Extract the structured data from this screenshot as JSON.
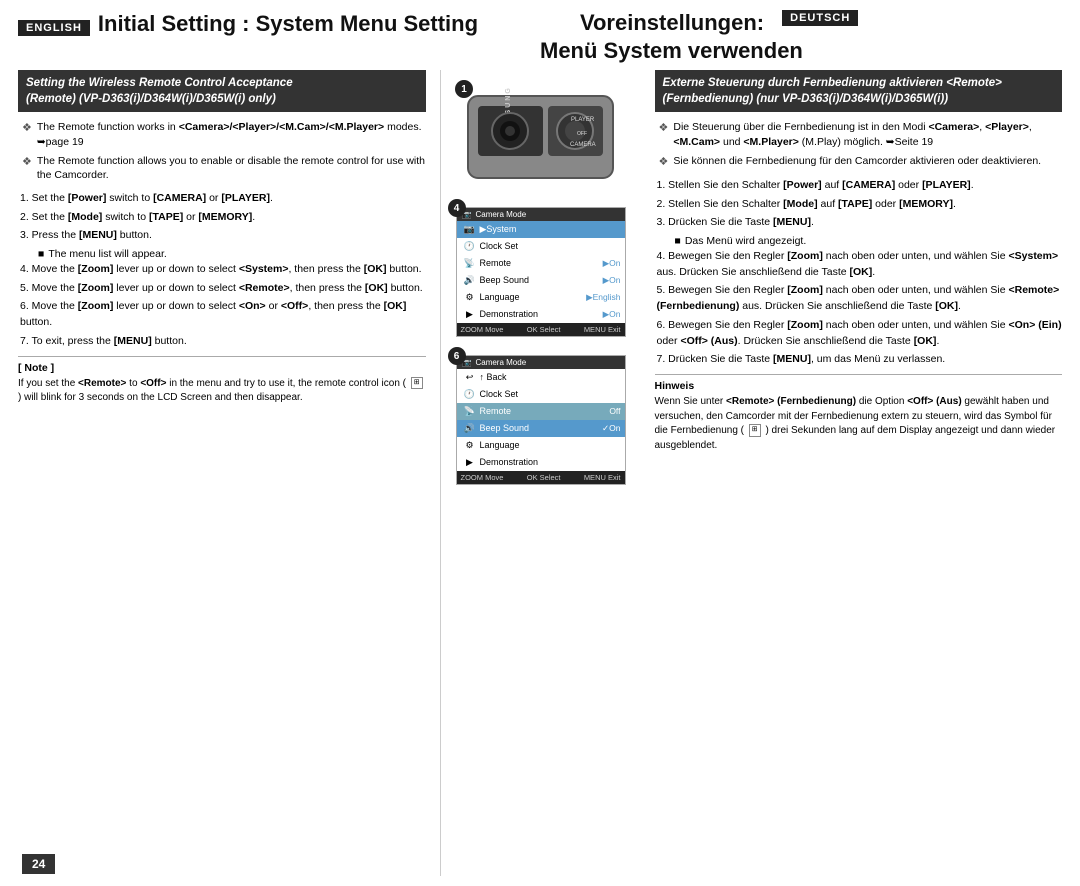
{
  "header": {
    "english_badge": "ENGLISH",
    "deutsch_badge": "DEUTSCH",
    "title_en": "Initial Setting : System Menu Setting",
    "title_de_pre": "Voreinstellungen:",
    "title_de_post": "Menü System verwenden"
  },
  "left": {
    "section_header_line1": "Setting the Wireless Remote Control Acceptance",
    "section_header_line2": "(Remote) (VP-D363(i)/D364W(i)/D365W(i) only)",
    "bullets": [
      "The Remote function works in <Camera>/<Player>/<M.Cam>/<M.Player> modes. ➥page 19",
      "The Remote function allows you to enable or disable the remote control for use with the Camcorder."
    ],
    "steps": [
      "Set the [Power] switch to [CAMERA] or [PLAYER].",
      "Set the [Mode] switch to [TAPE] or [MEMORY].",
      "Press the [MENU] button.",
      "The menu list will appear.",
      "Move the [Zoom] lever up or down to select <System>, then press the [OK] button.",
      "Move the [Zoom] lever up or down to select <Remote>, then press the [OK] button.",
      "Move the [Zoom] lever up or down to select <On> or <Off>, then press the [OK] button.",
      "To exit, press the [MENU] button."
    ],
    "note_title": "[ Note ]",
    "note_text": "If you set the <Remote> to <Off> in the menu and try to use it, the remote control icon (  ) will blink for 3 seconds on the LCD Screen and then disappear."
  },
  "right": {
    "section_header_line1": "Externe Steuerung durch Fernbedienung aktivieren <Remote>",
    "section_header_line2": "(Fernbedienung) (nur VP-D363(i)/D364W(i)/D365W(i))",
    "bullets": [
      "Die Steuerung über die Fernbedienung ist in den Modi <Camera>, <Player>, <M.Cam> und <M.Player> (M.Play) möglich. ➥Seite 19",
      "Sie können die Fernbedienung für den Camcorder aktivieren oder deaktivieren."
    ],
    "steps_de": [
      "Stellen Sie den Schalter [Power] auf [CAMERA] oder [PLAYER].",
      "Stellen Sie den Schalter [Mode] auf [TAPE] oder [MEMORY].",
      "Drücken Sie die Taste [MENU].",
      "Das Menü wird angezeigt.",
      "Bewegen Sie den Regler [Zoom] nach oben oder unten, und wählen Sie <System> aus. Drücken Sie anschließend die Taste [OK].",
      "Bewegen Sie den Regler [Zoom] nach oben oder unten, und wählen Sie <Remote> (Fernbedienung) aus. Drücken Sie anschließend die Taste [OK].",
      "Bewegen Sie den Regler [Zoom] nach oben oder unten, und wählen Sie <On> (Ein) oder <Off> (Aus). Drücken Sie anschließend die Taste [OK].",
      "Drücken Sie die Taste [MENU], um das Menü zu verlassen."
    ],
    "hinweis_title": "Hinweis",
    "hinweis_text": "Wenn Sie unter <Remote> (Fernbedienung) die Option <Off> (Aus) gewählt haben und versuchen, den Camcorder mit der Fernbedienung extern zu steuern, wird das Symbol für die Fernbedienung (  ) drei Sekunden lang auf dem Display angezeigt und dann wieder ausgeblendet."
  },
  "menu1": {
    "title": "Camera Mode",
    "rows": [
      {
        "icon": "camera",
        "label": "▶System",
        "value": "",
        "selected": true
      },
      {
        "icon": "clock",
        "label": "Clock Set",
        "value": ""
      },
      {
        "icon": "remote",
        "label": "Remote",
        "value": "▶On"
      },
      {
        "icon": "sound",
        "label": "Beep Sound",
        "value": "▶On"
      },
      {
        "icon": "lang",
        "label": "Language",
        "value": "▶English"
      },
      {
        "icon": "demo",
        "label": "Demonstration",
        "value": "▶On"
      }
    ],
    "footer": [
      "ZOOM Move",
      "OK Select",
      "MENU Exit"
    ]
  },
  "menu2": {
    "title": "Camera Mode",
    "rows": [
      {
        "icon": "back",
        "label": "↑ Back",
        "value": ""
      },
      {
        "icon": "clock",
        "label": "Clock Set",
        "value": ""
      },
      {
        "icon": "remote",
        "label": "Remote",
        "value": "Off",
        "highlight": true
      },
      {
        "icon": "sound",
        "label": "Beep Sound",
        "value": "✓On",
        "selected": true
      },
      {
        "icon": "lang",
        "label": "Language",
        "value": ""
      },
      {
        "icon": "demo",
        "label": "Demonstration",
        "value": ""
      }
    ],
    "footer": [
      "ZOOM Move",
      "OK Select",
      "MENU Exit"
    ]
  },
  "page_number": "24",
  "icons": {
    "camera": "📷",
    "clock": "🕐",
    "remote": "📡",
    "sound": "🔊",
    "lang": "⚙",
    "demo": "▶",
    "back": "↩"
  }
}
